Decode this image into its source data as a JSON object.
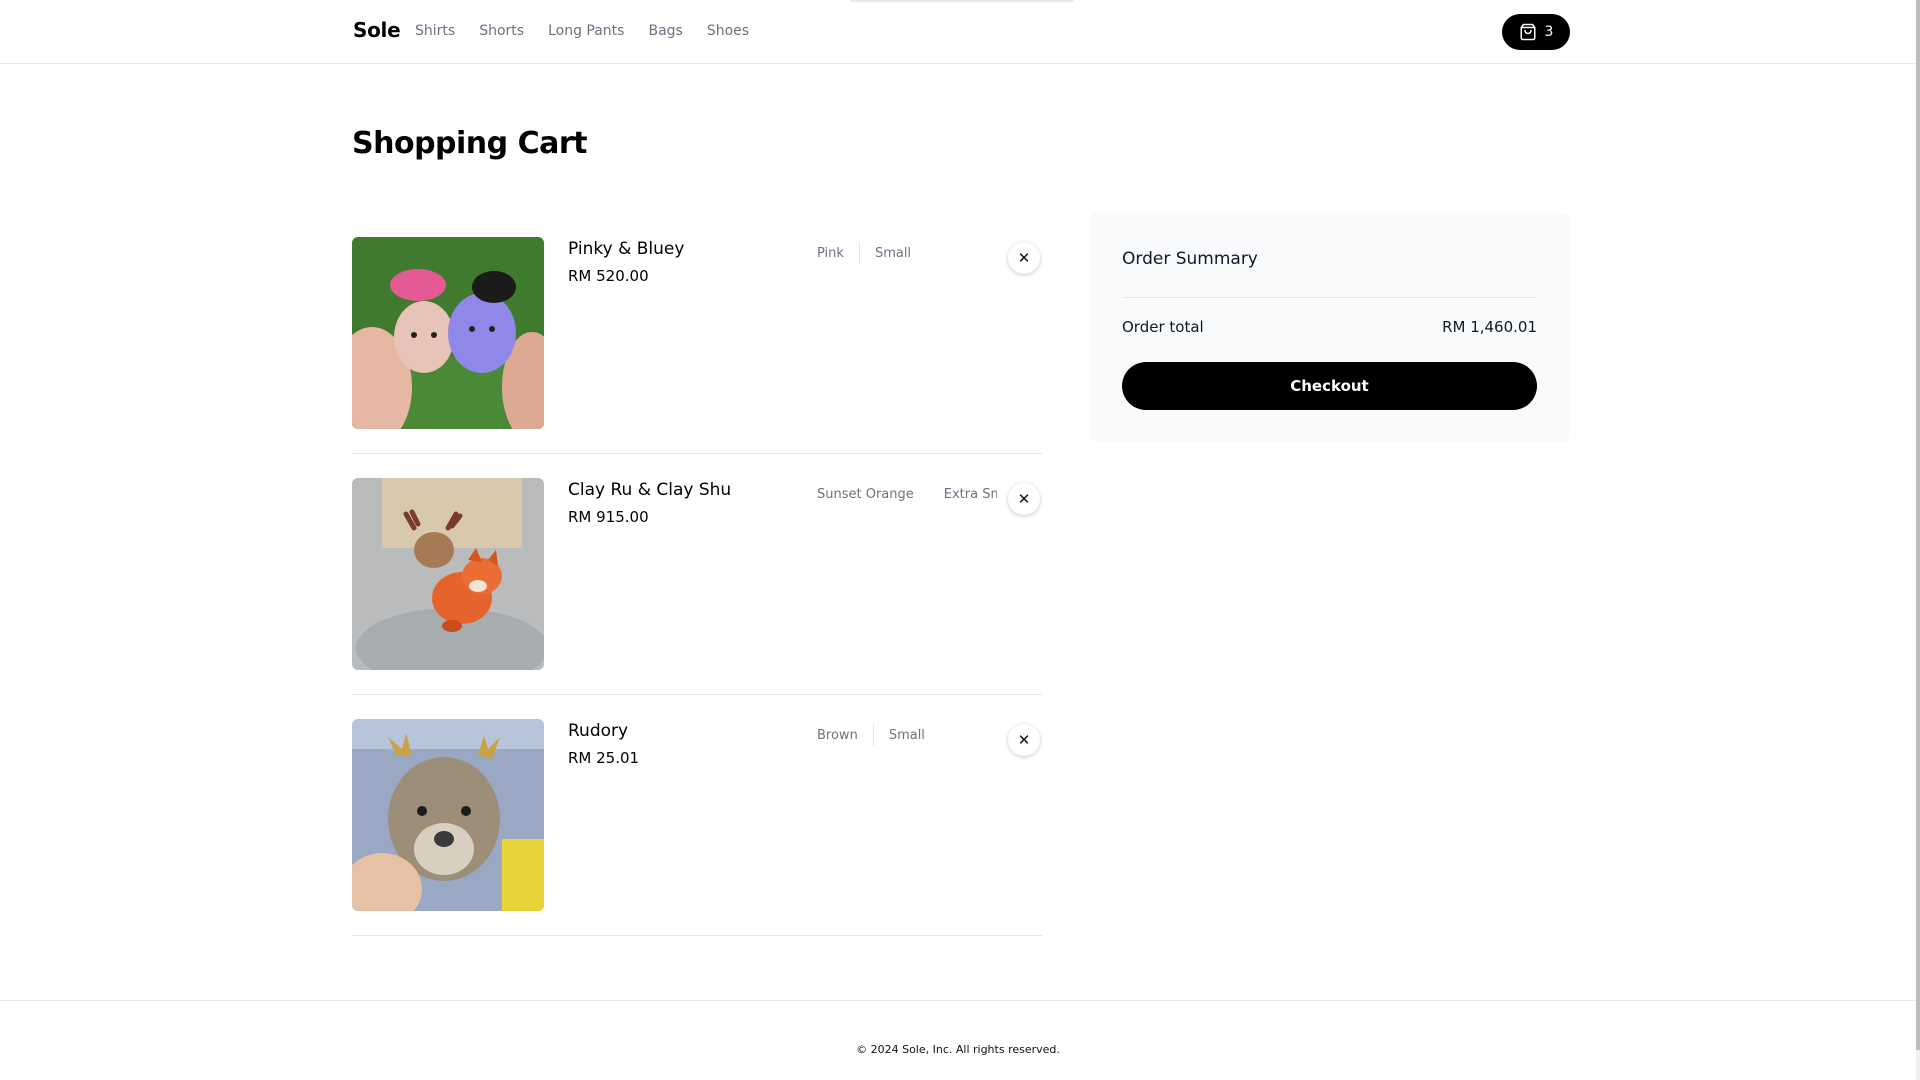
{
  "brand": "Sole",
  "nav": [
    "Shirts",
    "Shorts",
    "Long Pants",
    "Bags",
    "Shoes"
  ],
  "cart_count": "3",
  "page_title": "Shopping Cart",
  "items": [
    {
      "name": "Pinky & Bluey",
      "price": "RM 520.00",
      "color": "Pink",
      "size": "Small"
    },
    {
      "name": "Clay Ru & Clay Shu",
      "price": "RM 915.00",
      "color": "Sunset Orange",
      "size": "Extra Small"
    },
    {
      "name": "Rudory",
      "price": "RM 25.01",
      "color": "Brown",
      "size": "Small"
    }
  ],
  "summary": {
    "title": "Order Summary",
    "total_label": "Order total",
    "total_value": "RM 1,460.01",
    "checkout_label": "Checkout"
  },
  "footer": {
    "copyright": "© 2024 Sole, Inc. All rights reserved."
  },
  "icons": {
    "cart": "shopping-bag-icon",
    "remove": "close-icon"
  },
  "colors": {
    "accent": "#000000",
    "muted_text": "#6b7280",
    "summary_bg": "#f9fafb"
  }
}
